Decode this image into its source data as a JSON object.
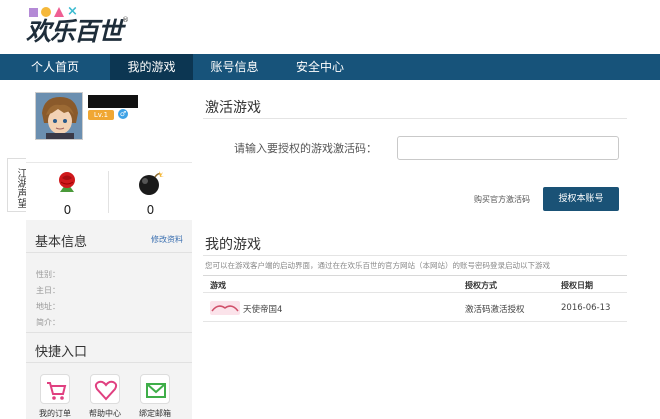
{
  "brand": {
    "logo_text": "欢乐百世",
    "logo_mark": "®",
    "colors": {
      "purple": "#b48ad6",
      "orange": "#f5b83a",
      "pink": "#ef5f93",
      "teal": "#3bbbd0"
    }
  },
  "nav": {
    "items": [
      {
        "label": "个人首页"
      },
      {
        "label": "我的游戏",
        "active": true
      },
      {
        "label": "账号信息"
      },
      {
        "label": "安全中心"
      }
    ],
    "bg_color": "#17537a",
    "active_color": "#0c3652"
  },
  "profile": {
    "level": "Lv.1",
    "gender_symbol": "♂",
    "side_tab": "江湖声望",
    "stats": [
      {
        "icon": "rose-icon",
        "value": "0"
      },
      {
        "icon": "bomb-icon",
        "value": "0"
      }
    ]
  },
  "basic_info": {
    "title": "基本信息",
    "edit_label": "修改资料",
    "fields": [
      {
        "label": "性别："
      },
      {
        "label": "主日："
      },
      {
        "label": "地址："
      },
      {
        "label": "简介："
      }
    ]
  },
  "quick_links": {
    "title": "快捷入口",
    "items": [
      {
        "label": "我的订单",
        "icon": "cart-icon"
      },
      {
        "label": "帮助中心",
        "icon": "heart-icon"
      },
      {
        "label": "绑定邮箱",
        "icon": "mail-icon"
      }
    ]
  },
  "activate": {
    "title": "激活游戏",
    "label": "请输入要授权的游戏激活码：",
    "input_value": "",
    "buy_link": "购买官方激活码",
    "button_label": "授权本账号"
  },
  "my_games": {
    "title": "我的游戏",
    "hint": "您可以在游戏客户端的启动界面，通过在在欢乐百世的官方网站（本网站）的账号密码登录启动以下游戏",
    "columns": [
      "游戏",
      "授权方式",
      "授权日期"
    ],
    "rows": [
      {
        "game": "天使帝国4",
        "method": "激活码激活授权",
        "date": "2016-06-13"
      }
    ]
  }
}
